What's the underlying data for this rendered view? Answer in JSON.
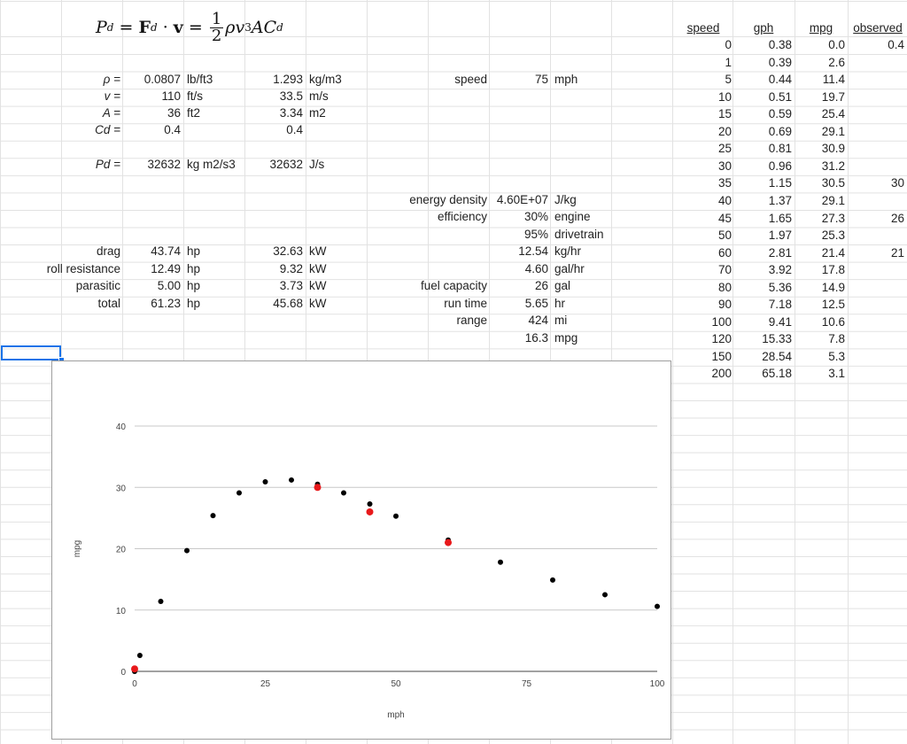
{
  "formula": {
    "lhs": "P",
    "lhs_sub": "d",
    "force": "F",
    "force_sub": "d",
    "vel": "v",
    "frac_num": "1",
    "frac_den": "2",
    "rho": "ρv",
    "exp": "3",
    "area": "AC",
    "area_sub": "d"
  },
  "inputs": {
    "rho_label": "ρ =",
    "rho_val": "0.0807",
    "rho_unit": "lb/ft3",
    "rho_si": "1.293",
    "rho_si_unit": "kg/m3",
    "v_label": "v =",
    "v_val": "110",
    "v_unit": "ft/s",
    "v_si": "33.5",
    "v_si_unit": "m/s",
    "a_label": "A =",
    "a_val": "36",
    "a_unit": "ft2",
    "a_si": "3.34",
    "a_si_unit": "m2",
    "cd_label": "Cd =",
    "cd_val": "0.4",
    "cd_si": "0.4",
    "pd_label": "Pd =",
    "pd_val": "32632",
    "pd_unit": "kg m2/s3",
    "pd_si": "32632",
    "pd_si_unit": "J/s"
  },
  "power": {
    "drag_label": "drag",
    "drag_hp": "43.74",
    "drag_unit": "hp",
    "drag_kw": "32.63",
    "drag_kw_unit": "kW",
    "roll_label": "roll resistance",
    "roll_hp": "12.49",
    "roll_unit": "hp",
    "roll_kw": "9.32",
    "roll_kw_unit": "kW",
    "par_label": "parasitic",
    "par_hp": "5.00",
    "par_unit": "hp",
    "par_kw": "3.73",
    "par_kw_unit": "kW",
    "tot_label": "total",
    "tot_hp": "61.23",
    "tot_unit": "hp",
    "tot_kw": "45.68",
    "tot_kw_unit": "kW"
  },
  "fuel": {
    "speed_label": "speed",
    "speed_val": "75",
    "speed_unit": "mph",
    "ed_label": "energy density",
    "ed_val": "4.60E+07",
    "ed_unit": "J/kg",
    "eff_label": "efficiency",
    "eff_val": "30%",
    "eff_unit": "engine",
    "dt_val": "95%",
    "dt_unit": "drivetrain",
    "kg_val": "12.54",
    "kg_unit": "kg/hr",
    "gal_val": "4.60",
    "gal_unit": "gal/hr",
    "cap_label": "fuel capacity",
    "cap_val": "26",
    "cap_unit": "gal",
    "run_label": "run time",
    "run_val": "5.65",
    "run_unit": "hr",
    "range_label": "range",
    "range_val": "424",
    "range_unit": "mi",
    "mpg_val": "16.3",
    "mpg_unit": "mpg"
  },
  "table": {
    "headers": [
      "speed",
      "gph",
      "mpg",
      "observed"
    ],
    "rows": [
      [
        "0",
        "0.38",
        "0.0",
        "0.4"
      ],
      [
        "1",
        "0.39",
        "2.6",
        ""
      ],
      [
        "5",
        "0.44",
        "11.4",
        ""
      ],
      [
        "10",
        "0.51",
        "19.7",
        ""
      ],
      [
        "15",
        "0.59",
        "25.4",
        ""
      ],
      [
        "20",
        "0.69",
        "29.1",
        ""
      ],
      [
        "25",
        "0.81",
        "30.9",
        ""
      ],
      [
        "30",
        "0.96",
        "31.2",
        ""
      ],
      [
        "35",
        "1.15",
        "30.5",
        "30"
      ],
      [
        "40",
        "1.37",
        "29.1",
        ""
      ],
      [
        "45",
        "1.65",
        "27.3",
        "26"
      ],
      [
        "50",
        "1.97",
        "25.3",
        ""
      ],
      [
        "60",
        "2.81",
        "21.4",
        "21"
      ],
      [
        "70",
        "3.92",
        "17.8",
        ""
      ],
      [
        "80",
        "5.36",
        "14.9",
        ""
      ],
      [
        "90",
        "7.18",
        "12.5",
        ""
      ],
      [
        "100",
        "9.41",
        "10.6",
        ""
      ],
      [
        "120",
        "15.33",
        "7.8",
        ""
      ],
      [
        "150",
        "28.54",
        "5.3",
        ""
      ],
      [
        "200",
        "65.18",
        "3.1",
        ""
      ]
    ]
  },
  "chart_data": {
    "type": "scatter",
    "title": "",
    "xlabel": "mph",
    "ylabel": "mpg",
    "xlim": [
      0,
      100
    ],
    "ylim": [
      0,
      40
    ],
    "xticks": [
      0,
      25,
      50,
      75,
      100
    ],
    "yticks": [
      0,
      10,
      20,
      30,
      40
    ],
    "grid": true,
    "series": [
      {
        "color": "#000000",
        "x": [
          0,
          1,
          5,
          10,
          15,
          20,
          25,
          30,
          35,
          40,
          45,
          50,
          60,
          70,
          80,
          90,
          100
        ],
        "y": [
          0.0,
          2.6,
          11.4,
          19.7,
          25.4,
          29.1,
          30.9,
          31.2,
          30.5,
          29.1,
          27.3,
          25.3,
          21.4,
          17.8,
          14.9,
          12.5,
          10.6
        ]
      },
      {
        "color": "#e8191b",
        "x": [
          0,
          35,
          45,
          60
        ],
        "y": [
          0.4,
          30,
          26,
          21
        ]
      }
    ]
  }
}
